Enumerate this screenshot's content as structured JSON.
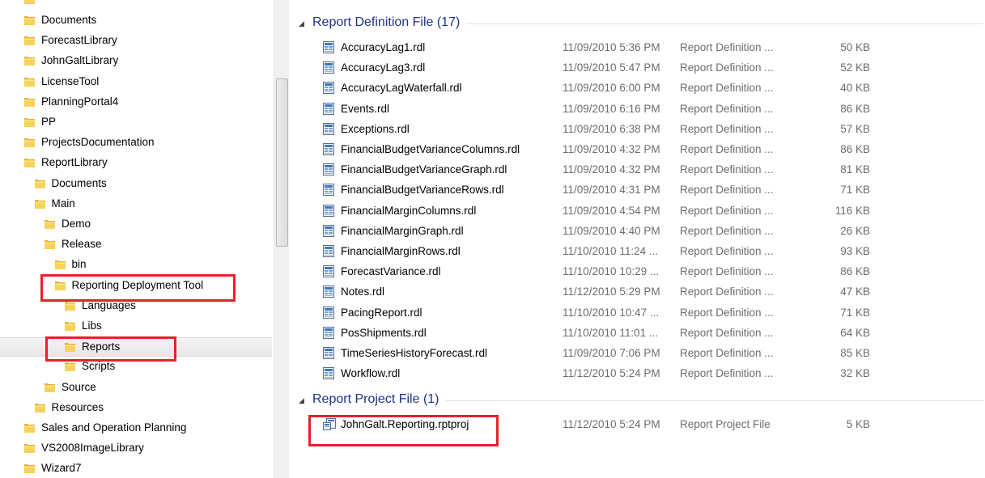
{
  "colors": {
    "folder_yellow": "#f7d25c",
    "group_title": "#1e3287",
    "highlight_red": "#e8202a",
    "meta_gray": "#6d6d6d"
  },
  "navigation": {
    "items": [
      {
        "label": "Documents",
        "level": 0
      },
      {
        "label": "ForecastLibrary",
        "level": 0
      },
      {
        "label": "JohnGaltLibrary",
        "level": 0
      },
      {
        "label": "LicenseTool",
        "level": 0
      },
      {
        "label": "PlanningPortal4",
        "level": 0
      },
      {
        "label": "PP",
        "level": 0
      },
      {
        "label": "ProjectsDocumentation",
        "level": 0
      },
      {
        "label": "ReportLibrary",
        "level": 0
      },
      {
        "label": "Documents",
        "level": 1
      },
      {
        "label": "Main",
        "level": 1
      },
      {
        "label": "Demo",
        "level": 2
      },
      {
        "label": "Release",
        "level": 2
      },
      {
        "label": "bin",
        "level": 3
      },
      {
        "label": "Reporting Deployment Tool",
        "level": 3
      },
      {
        "label": "Languages",
        "level": 4
      },
      {
        "label": "Libs",
        "level": 4
      },
      {
        "label": "Reports",
        "level": 4,
        "selected": true
      },
      {
        "label": "Scripts",
        "level": 4
      },
      {
        "label": "Source",
        "level": 2
      },
      {
        "label": "Resources",
        "level": 1
      },
      {
        "label": "Sales and Operation Planning",
        "level": 0
      },
      {
        "label": "VS2008ImageLibrary",
        "level": 0
      },
      {
        "label": "Wizard7",
        "level": 0
      }
    ]
  },
  "groups": [
    {
      "title": "Report Definition File (17)",
      "files": [
        {
          "name": "AccuracyLag1.rdl",
          "date": "11/09/2010 5:36 PM",
          "type": "Report Definition ...",
          "size": "50 KB"
        },
        {
          "name": "AccuracyLag3.rdl",
          "date": "11/09/2010 5:47 PM",
          "type": "Report Definition ...",
          "size": "52 KB"
        },
        {
          "name": "AccuracyLagWaterfall.rdl",
          "date": "11/09/2010 6:00 PM",
          "type": "Report Definition ...",
          "size": "40 KB"
        },
        {
          "name": "Events.rdl",
          "date": "11/09/2010 6:16 PM",
          "type": "Report Definition ...",
          "size": "86 KB"
        },
        {
          "name": "Exceptions.rdl",
          "date": "11/09/2010 6:38 PM",
          "type": "Report Definition ...",
          "size": "57 KB"
        },
        {
          "name": "FinancialBudgetVarianceColumns.rdl",
          "date": "11/09/2010 4:32 PM",
          "type": "Report Definition ...",
          "size": "86 KB"
        },
        {
          "name": "FinancialBudgetVarianceGraph.rdl",
          "date": "11/09/2010 4:32 PM",
          "type": "Report Definition ...",
          "size": "81 KB"
        },
        {
          "name": "FinancialBudgetVarianceRows.rdl",
          "date": "11/09/2010 4:31 PM",
          "type": "Report Definition ...",
          "size": "71 KB"
        },
        {
          "name": "FinancialMarginColumns.rdl",
          "date": "11/09/2010 4:54 PM",
          "type": "Report Definition ...",
          "size": "116 KB"
        },
        {
          "name": "FinancialMarginGraph.rdl",
          "date": "11/09/2010 4:40 PM",
          "type": "Report Definition ...",
          "size": "26 KB"
        },
        {
          "name": "FinancialMarginRows.rdl",
          "date": "11/10/2010 11:24 ...",
          "type": "Report Definition ...",
          "size": "93 KB"
        },
        {
          "name": "ForecastVariance.rdl",
          "date": "11/10/2010 10:29 ...",
          "type": "Report Definition ...",
          "size": "86 KB"
        },
        {
          "name": "Notes.rdl",
          "date": "11/12/2010 5:29 PM",
          "type": "Report Definition ...",
          "size": "47 KB"
        },
        {
          "name": "PacingReport.rdl",
          "date": "11/10/2010 10:47 ...",
          "type": "Report Definition ...",
          "size": "71 KB"
        },
        {
          "name": "PosShipments.rdl",
          "date": "11/10/2010 11:01 ...",
          "type": "Report Definition ...",
          "size": "64 KB"
        },
        {
          "name": "TimeSeriesHistoryForecast.rdl",
          "date": "11/09/2010 7:06 PM",
          "type": "Report Definition ...",
          "size": "85 KB"
        },
        {
          "name": "Workflow.rdl",
          "date": "11/12/2010 5:24 PM",
          "type": "Report Definition ...",
          "size": "32 KB"
        }
      ]
    },
    {
      "title": "Report Project File (1)",
      "files": [
        {
          "name": "JohnGalt.Reporting.rptproj",
          "date": "11/12/2010 5:24 PM",
          "type": "Report Project File",
          "size": "5 KB"
        }
      ]
    }
  ]
}
